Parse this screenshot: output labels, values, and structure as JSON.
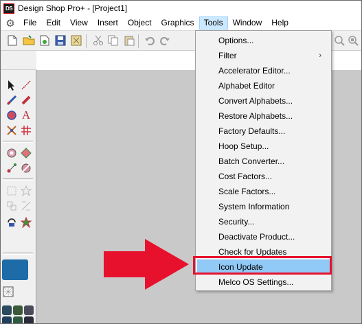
{
  "window": {
    "logo_text": "DS",
    "title": "Design Shop Pro+ - [Project1]"
  },
  "menubar": {
    "items": [
      "File",
      "Edit",
      "View",
      "Insert",
      "Object",
      "Graphics",
      "Tools",
      "Window",
      "Help"
    ],
    "active": "Tools"
  },
  "tools_menu": {
    "items": [
      {
        "label": "Options..."
      },
      {
        "label": "Filter",
        "submenu": true
      },
      {
        "label": "Accelerator Editor..."
      },
      {
        "label": "Alphabet Editor"
      },
      {
        "label": "Convert Alphabets..."
      },
      {
        "label": "Restore Alphabets..."
      },
      {
        "label": "Factory Defaults..."
      },
      {
        "label": "Hoop Setup..."
      },
      {
        "label": "Batch Converter..."
      },
      {
        "label": "Cost Factors..."
      },
      {
        "label": "Scale Factors..."
      },
      {
        "label": "System Information"
      },
      {
        "label": "Security..."
      },
      {
        "label": "Deactivate Product..."
      },
      {
        "label": "Check for Updates"
      },
      {
        "label": "Icon Update",
        "highlighted": true
      },
      {
        "label": "Melco OS Settings..."
      }
    ],
    "submenu_glyph": "›"
  },
  "colors": {
    "highlight_fill": "#91c9f7",
    "callout_red": "#e8112d",
    "workspace": "#c9c9c9",
    "swatch_blue": "#1d6ca8"
  },
  "icons": {
    "gear": "gear-icon",
    "toolbar": [
      "new-document-icon",
      "open-folder-icon",
      "open-design-icon",
      "save-icon",
      "import-icon",
      "cut-icon",
      "copy-icon",
      "paste-icon",
      "undo-icon",
      "redo-icon",
      "zoom-icon",
      "zoom-fit-icon"
    ],
    "palette": [
      "select-arrow-icon",
      "line-draw-icon",
      "stitch-icon",
      "eraser-icon",
      "circle-fill-icon",
      "letter-a-icon",
      "cross-stitch-icon",
      "fill-pattern-icon",
      "shape-icon",
      "pattern-icon",
      "node-icon",
      "shape-edit-icon",
      "align-icon",
      "star-icon",
      "group-icon",
      "transform-icon",
      "rotate-icon",
      "star-color-icon"
    ]
  }
}
